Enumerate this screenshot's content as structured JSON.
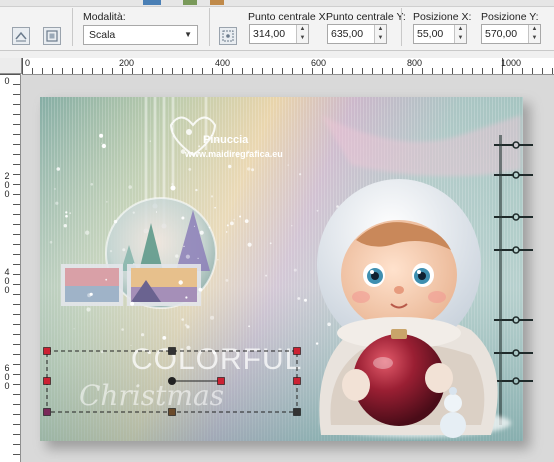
{
  "toolbar": {
    "mode_label": "Modalità:",
    "mode_value": "Scala",
    "center_x_label": "Punto centrale X:",
    "center_x_value": "314,00",
    "center_y_label": "Punto centrale Y:",
    "center_y_value": "635,00",
    "pos_x_label": "Posizione X:",
    "pos_x_value": "55,00",
    "pos_y_label": "Posizione Y:",
    "pos_y_value": "570,00"
  },
  "ruler": {
    "h_labels": [
      "0",
      "200",
      "400",
      "600",
      "800",
      "1000"
    ],
    "v_labels": [
      [
        "0"
      ],
      [
        "2",
        "0",
        "0"
      ],
      [
        "4",
        "0",
        "0"
      ],
      [
        "6",
        "0",
        "0"
      ]
    ]
  },
  "artwork": {
    "watermark_name": "Pinuccia",
    "watermark_url": "www.maidiregrafica.eu",
    "title_word1": "COLORFUL",
    "title_word2": "Christmas"
  },
  "colors": {
    "selection": "#cc2233",
    "accent": "#4a7fb5"
  }
}
